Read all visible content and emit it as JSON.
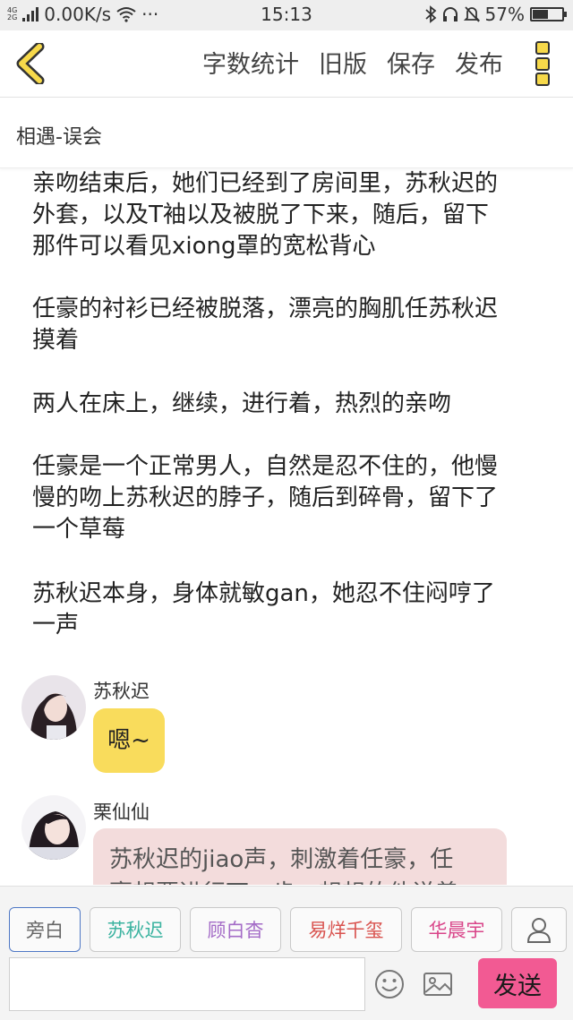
{
  "status_bar": {
    "network_top": "4G",
    "network_bottom": "2G",
    "speed": "0.00K/s",
    "dots": "···",
    "time": "15:13",
    "battery": "57%",
    "battery_level": 0.57
  },
  "header": {
    "actions": [
      "字数统计",
      "旧版",
      "保存",
      "发布"
    ],
    "accent_color": "#f7d94a"
  },
  "chapter_title": "相遇-误会",
  "paragraphs": [
    [
      "亲吻结束后，她们已经到了房间里，苏秋迟的",
      "外套，以及T袖以及被脱了下来，随后，留下",
      "那件可以看见xiong罩的宽松背心"
    ],
    [
      "任豪的衬衫已经被脱落，漂亮的胸肌任苏秋迟",
      "摸着"
    ],
    [
      "两人在床上，继续，进行着，热烈的亲吻"
    ],
    [
      "任豪是一个正常男人，自然是忍不住的，他慢",
      "慢的吻上苏秋迟的脖子，随后到碎骨，留下了",
      "一个草莓"
    ],
    [
      "苏秋迟本身，身体就敏gan，她忍不住闷哼了",
      "一声"
    ]
  ],
  "messages": [
    {
      "name": "苏秋迟",
      "text": "嗯~",
      "bubble_color": "#f9dc5c"
    },
    {
      "name": "栗仙仙",
      "text_lines": [
        "苏秋迟的jiao声，刺激着任豪，任",
        "豪想要进行下一步，想想的他说着"
      ],
      "bubble_color": "#f3dcdc"
    }
  ],
  "roles": [
    {
      "label": "旁白",
      "color": "#666666",
      "active": true
    },
    {
      "label": "苏秋迟",
      "color": "#3bb3a0",
      "active": false
    },
    {
      "label": "顾白杳",
      "color": "#a46cc7",
      "active": false
    },
    {
      "label": "易烊千玺",
      "color": "#d9534f",
      "active": false
    },
    {
      "label": "华晨宇",
      "color": "#d9468a",
      "active": false
    }
  ],
  "send_label": "发送"
}
